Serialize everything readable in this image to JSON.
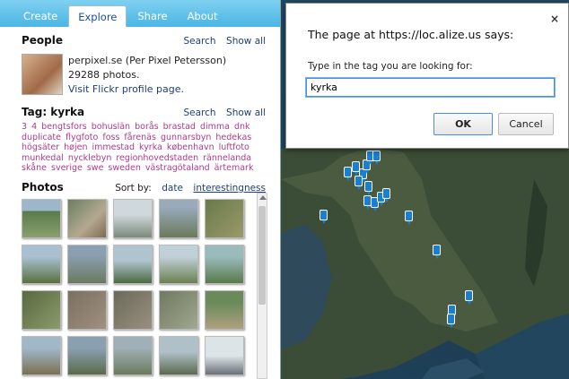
{
  "tabs": [
    "Create",
    "Explore",
    "Share",
    "About"
  ],
  "people": {
    "title": "People",
    "search": "Search",
    "show_all": "Show all",
    "name": "perpixel.se (Per Pixel Petersson)",
    "photos": "29288 photos.",
    "profile_link": "Visit Flickr profile page."
  },
  "tag": {
    "title": "Tag: kyrka",
    "search": "Search",
    "show_all": "Show all",
    "cloud": "3 4 bengtsfors bohuslän borås brastad dimma dnk duplicate flygfoto foss fårenäs gunnarsbyn hedekas högsäter højen immestad kyrka københavn luftfoto munkedal nycklebyn regionhovedstaden rännelanda skåne sverige swe sweden västragötaland ärtemark"
  },
  "photos": {
    "title": "Photos",
    "sort_by": "Sort by:",
    "date": "date",
    "interestingness": "interestingness"
  },
  "dialog": {
    "title": "The page at https://loc.alize.us says:",
    "close": "×",
    "message": "Type in the tag you are looking for:",
    "input_value": "kyrka",
    "ok": "OK",
    "cancel": "Cancel"
  },
  "colors": {
    "tab_bar": "#4bb6e4",
    "link": "#1a3f7a",
    "tag": "#b03a8a",
    "pin": "#1a7fd0"
  }
}
